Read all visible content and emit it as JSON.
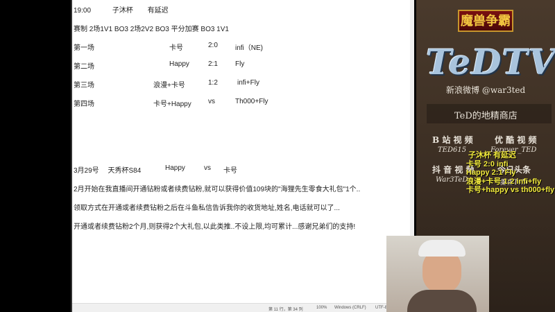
{
  "editor": {
    "header": {
      "time": "19:00",
      "cup": "子沐杯",
      "note": "有延迟"
    },
    "format": "赛制 2场1V1 BO3   2场2V2 BO3   平分加赛 BO3 1V1",
    "matches": [
      {
        "round": "第一场",
        "left": "卡号",
        "score": "2:0",
        "right": "infi（NE)"
      },
      {
        "round": "第二场",
        "left": "Happy",
        "score": "2:1",
        "right": "Fly"
      },
      {
        "round": "第三场",
        "left": "浪漫+卡号",
        "score": "1:2",
        "right": "infi+Fly"
      },
      {
        "round": "第四场",
        "left": "卡号+Happy",
        "score": "vs",
        "right": "Th000+Fly"
      }
    ],
    "next": {
      "date": "3月29号",
      "cup": "天秀杯S84",
      "left": "Happy",
      "vs": "vs",
      "right": "卡号"
    },
    "promo": [
      "2月开始在我直播间开通钻粉或者续费钻粉,就可以获得价值109块的\"海狸先生零食大礼包\"1个..",
      "领取方式在开通或者续费钻粉之后在斗鱼私信告诉我你的收货地址,姓名,电话就可以了...",
      "开通或者续费钻粉2个月,则获得2个大礼包,以此类推..不设上限,均可累计...感谢兄弟们的支持!"
    ],
    "status": {
      "position": "第 11 行，第 34 列",
      "zoom": "100%",
      "eol": "Windows (CRLF)",
      "encoding": "UTF-8"
    }
  },
  "panel": {
    "game_logo": "魔兽争霸",
    "brand": "TeDTV",
    "weibo": "新浪微博 @war3ted",
    "shop": "TeD的地精商店",
    "bilibili_label": "B 站 视 频",
    "bilibili_id": "TED615",
    "youku_label": "优 酷 视 频",
    "youku_id": "Forever_TED",
    "douyin_label": "抖 音 视 频",
    "douyin_id": "War3TeD",
    "toutiao_label": "今日头条",
    "toutiao_id": "魔兽TeD"
  },
  "overlay": [
    "子沐杯  有延迟",
    "卡号 2:0 infi",
    "Happy 2:1 Fly",
    "浪漫+卡号 1:2 infi+fly",
    "卡号+happy vs th000+fly"
  ]
}
